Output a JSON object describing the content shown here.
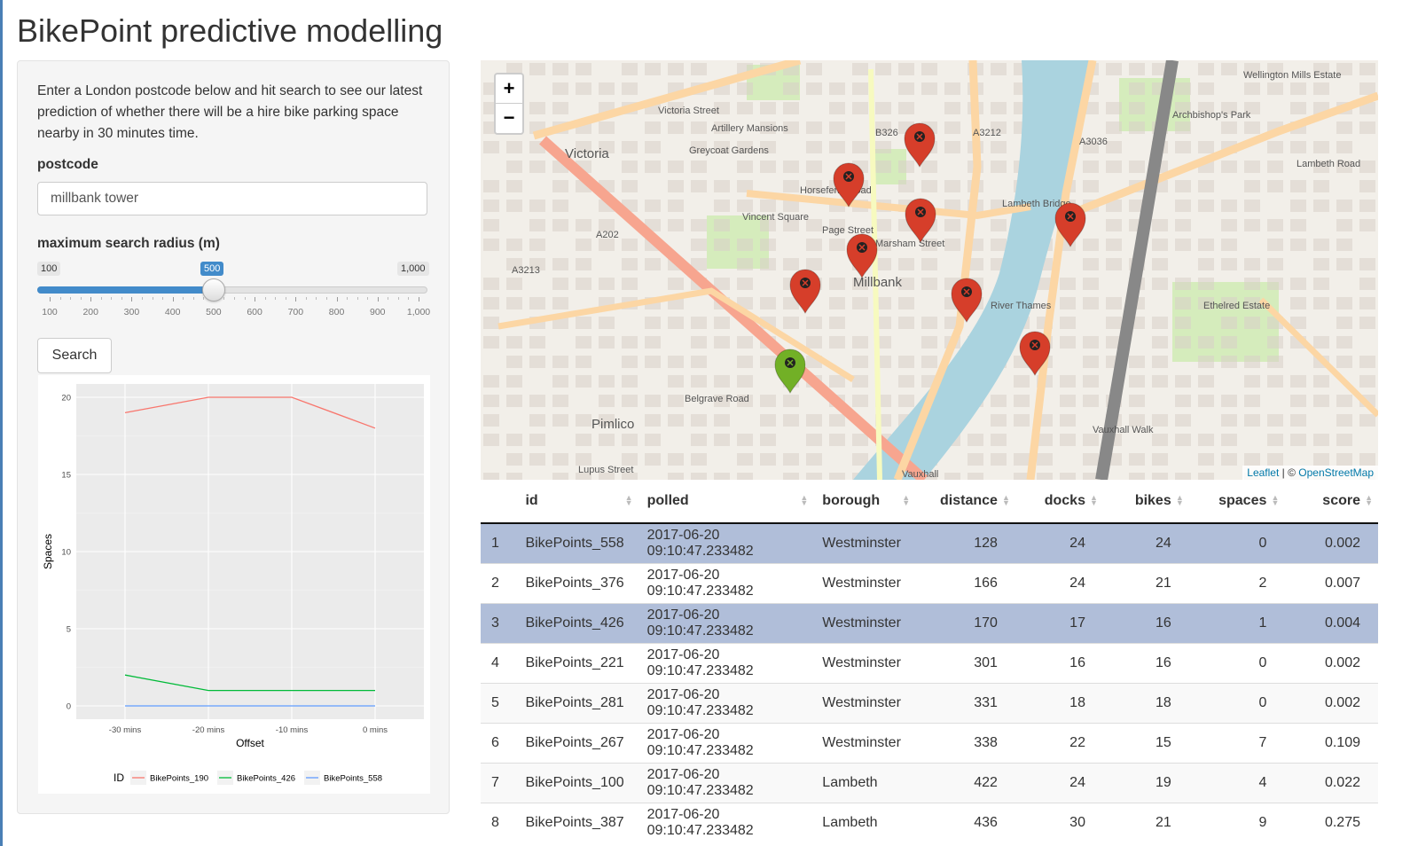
{
  "app": {
    "title": "BikePoint predictive modelling"
  },
  "sidebar": {
    "intro": "Enter a London postcode below and hit search to see our latest prediction of whether there will be a hire bike parking space nearby in 30 minutes time.",
    "postcode_label": "postcode",
    "postcode_value": "millbank tower",
    "radius_label": "maximum search radius (m)",
    "slider": {
      "min_label": "100",
      "max_label": "1,000",
      "value_label": "500",
      "value": 500,
      "min": 100,
      "max": 1000,
      "tick_labels": [
        "100",
        "200",
        "300",
        "400",
        "500",
        "600",
        "700",
        "800",
        "900",
        "1,000"
      ]
    },
    "search_label": "Search"
  },
  "chart_data": {
    "type": "line",
    "xlabel": "Offset",
    "ylabel": "Spaces",
    "x": [
      "-30 mins",
      "-20 mins",
      "-10 mins",
      "0 mins"
    ],
    "ylim": [
      0,
      20
    ],
    "yticks": [
      "0",
      "5",
      "10",
      "15",
      "20"
    ],
    "legend_title": "ID",
    "legend_position": "bottom",
    "grid": true,
    "series": [
      {
        "name": "BikePoints_190",
        "color": "#F8766D",
        "values": [
          19,
          20,
          20,
          18
        ]
      },
      {
        "name": "BikePoints_426",
        "color": "#00BA38",
        "values": [
          2,
          1,
          1,
          1
        ]
      },
      {
        "name": "BikePoints_558",
        "color": "#619CFF",
        "values": [
          0,
          0,
          0,
          0
        ]
      }
    ]
  },
  "map": {
    "zoom_in": "+",
    "zoom_out": "−",
    "attribution_leaflet": "Leaflet",
    "attribution_sep": " | © ",
    "attribution_osm": "OpenStreetMap",
    "labels": [
      "Victoria",
      "Victoria Street",
      "Artillery Mansions",
      "Greycoat Gardens",
      "Horseferry Road",
      "Millbank",
      "Lambeth Bridge",
      "Pimlico",
      "Belgrave Road",
      "Vauxhall",
      "Ethelred Estate",
      "Lambeth Road",
      "River Thames",
      "A3212",
      "A3036",
      "B326",
      "A202",
      "A3213",
      "Page Street",
      "Marsham Street",
      "Vincent Square",
      "Lupus Street",
      "Vauxhall Walk",
      "Wellington Mills Estate",
      "Archbishop's Park"
    ],
    "marker_colors": {
      "red": "#d63e2a",
      "green": "#72b026"
    }
  },
  "table": {
    "columns": [
      "",
      "id",
      "polled",
      "borough",
      "distance",
      "docks",
      "bikes",
      "spaces",
      "score"
    ],
    "rows": [
      [
        "1",
        "BikePoints_558",
        "2017-06-20 09:10:47.233482",
        "Westminster",
        "128",
        "24",
        "24",
        "0",
        "0.002"
      ],
      [
        "2",
        "BikePoints_376",
        "2017-06-20 09:10:47.233482",
        "Westminster",
        "166",
        "24",
        "21",
        "2",
        "0.007"
      ],
      [
        "3",
        "BikePoints_426",
        "2017-06-20 09:10:47.233482",
        "Westminster",
        "170",
        "17",
        "16",
        "1",
        "0.004"
      ],
      [
        "4",
        "BikePoints_221",
        "2017-06-20 09:10:47.233482",
        "Westminster",
        "301",
        "16",
        "16",
        "0",
        "0.002"
      ],
      [
        "5",
        "BikePoints_281",
        "2017-06-20 09:10:47.233482",
        "Westminster",
        "331",
        "18",
        "18",
        "0",
        "0.002"
      ],
      [
        "6",
        "BikePoints_267",
        "2017-06-20 09:10:47.233482",
        "Westminster",
        "338",
        "22",
        "15",
        "7",
        "0.109"
      ],
      [
        "7",
        "BikePoints_100",
        "2017-06-20 09:10:47.233482",
        "Lambeth",
        "422",
        "24",
        "19",
        "4",
        "0.022"
      ],
      [
        "8",
        "BikePoints_387",
        "2017-06-20 09:10:47.233482",
        "Lambeth",
        "436",
        "30",
        "21",
        "9",
        "0.275"
      ]
    ],
    "selected_rows": [
      1,
      3
    ]
  }
}
